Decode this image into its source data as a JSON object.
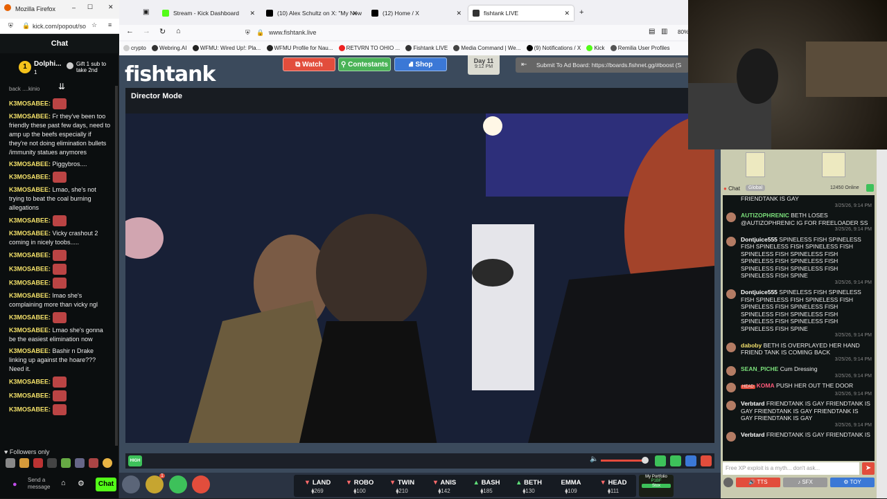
{
  "kick": {
    "window_title": "Mozilla Firefox",
    "url": "kick.com/popout/so",
    "header": "Chat",
    "pinned_user": "Dolphi...",
    "pinned_sub_count": "1",
    "gift_text": "Gift 1 sub to take 2nd",
    "partial_top": "back ....kinio",
    "messages": [
      {
        "user": "K3MOSABEE:",
        "text": ""
      },
      {
        "user": "K3MOSABEE:",
        "text": "Fr they've been too friendly these past few days, need to amp up the beefs especially if they're not doing elimination bullets /immunity statues anymores"
      },
      {
        "user": "K3MOSABEE:",
        "text": "Piggybros...."
      },
      {
        "user": "K3MOSABEE:",
        "text": ""
      },
      {
        "user": "K3MOSABEE:",
        "text": "Lmao, she's not trying to beat the coal burning allegations"
      },
      {
        "user": "K3MOSABEE:",
        "text": ""
      },
      {
        "user": "K3MOSABEE:",
        "text": "Vicky crashout 2 coming in nicely toobs....."
      },
      {
        "user": "K3MOSABEE:",
        "text": ""
      },
      {
        "user": "K3MOSABEE:",
        "text": ""
      },
      {
        "user": "K3MOSABEE:",
        "text": ""
      },
      {
        "user": "K3MOSABEE:",
        "text": "lmao she's complaining more than vicky ngl"
      },
      {
        "user": "K3MOSABEE:",
        "text": ""
      },
      {
        "user": "K3MOSABEE:",
        "text": "Lmao she's gonna be the easiest elimination now"
      },
      {
        "user": "K3MOSABEE:",
        "text": "Bashir n Drake linking up against the hoare??? Need it."
      },
      {
        "user": "K3MOSABEE:",
        "text": ""
      },
      {
        "user": "K3MOSABEE:",
        "text": ""
      },
      {
        "user": "K3MOSABEE:",
        "text": ""
      }
    ],
    "followers_only": "Followers only",
    "input_placeholder": "Send a message",
    "chat_button": "Chat"
  },
  "browser": {
    "tabs": [
      {
        "label": "Stream - Kick Dashboard",
        "color": "#53fc18"
      },
      {
        "label": "(10) Alex Schultz on X: \"My New",
        "color": "#000000"
      },
      {
        "label": "(12) Home / X",
        "color": "#000000"
      },
      {
        "label": "fishtank LIVE",
        "color": "#111111"
      }
    ],
    "url": "www.fishtank.live",
    "zoom": "80%",
    "bookmarks": [
      "crypto",
      "Webring.AI",
      "WFMU: Wired Up!: Pla...",
      "WFMU Profile for Nau...",
      "RETVRN TO OHIO ...",
      "Fishtank LIVE",
      "Media Command | We...",
      "(9) Notifications / X",
      "Kick",
      "Remilia User Profiles"
    ]
  },
  "fishtank": {
    "logo": "fishtank",
    "watch": "Watch",
    "contestants": "Contestants",
    "shop": "Shop",
    "day": "Day 11",
    "time": "9:12 PM",
    "ad_board": "Submit To Ad Board: https://boards.fishnet.gg/#boost (S",
    "director_mode": "Director Mode",
    "quality": "HIGH",
    "cast": [
      {
        "name": "LAND",
        "score": "269",
        "trend": "down",
        "color": "#ff6b6b"
      },
      {
        "name": "ROBO",
        "score": "100",
        "trend": "down",
        "color": "#ff6b6b"
      },
      {
        "name": "TWIN",
        "score": "210",
        "trend": "down",
        "color": "#ff6b6b"
      },
      {
        "name": "ANIS",
        "score": "142",
        "trend": "down",
        "color": "#ff6b6b"
      },
      {
        "name": "BASH",
        "score": "185",
        "trend": "up",
        "color": "#5fe07a"
      },
      {
        "name": "BETH",
        "score": "130",
        "trend": "up",
        "color": "#5fe07a"
      },
      {
        "name": "EMMA",
        "score": "109",
        "trend": "none",
        "color": "#ffffff"
      },
      {
        "name": "HEAD",
        "score": "111",
        "trend": "down",
        "color": "#ff6b6b"
      }
    ],
    "portfolio_label": "My Portfolio",
    "portfolio_value": "P1BF",
    "portfolio_btn": "Stox",
    "badge_count": "1"
  },
  "right_chat": {
    "tab_chat": "Chat",
    "tab_global": "Global",
    "online": "12450 Online",
    "first_partial": "FRIENDTANK IS GAY",
    "first_ts": "3/25/26, 9:14 PM",
    "messages": [
      {
        "user": "AUTIZOPHRENIC",
        "ucolor": "#7be07b",
        "text": "BETH LOSES @AUTIZOPHRENIC IG FOR FREELOADER SS",
        "ts": "3/25/26, 9:14 PM"
      },
      {
        "user": "Dontjuice555",
        "ucolor": "#ffffff",
        "text": "SPINELESS FISH SPINELESS FISH SPINELESS FISH SPINELESS FISH SPINELESS FISH SPINELESS FISH SPINELESS FISH SPINELESS FISH SPINELESS FISH SPINELESS FISH SPINELESS FISH SPINE",
        "ts": "3/25/26, 9:14 PM"
      },
      {
        "user": "Dontjuice555",
        "ucolor": "#ffffff",
        "text": "SPINELESS FISH SPINELESS FISH SPINELESS FISH SPINELESS FISH SPINELESS FISH SPINELESS FISH SPINELESS FISH SPINELESS FISH SPINELESS FISH SPINELESS FISH SPINELESS FISH SPINE",
        "ts": "3/25/26, 9:14 PM"
      },
      {
        "user": "daboby",
        "ucolor": "#f3e06b",
        "text": "BETH IS OVERPLAYED HER HAND FRIEND TANK IS COMING BACK",
        "ts": "3/25/26, 9:14 PM"
      },
      {
        "user": "SEAN_PICHE",
        "ucolor": "#7be07b",
        "text": "Cum Dressing",
        "ts": "3/25/26, 9:14 PM"
      },
      {
        "user": "KOMA",
        "ucolor": "#ff5a7a",
        "text": "PUSH HER OUT THE DOOR",
        "ts": "3/25/26, 9:14 PM",
        "badge": "HEAD"
      },
      {
        "user": "Verbtard",
        "ucolor": "#ffffff",
        "text": "FRIENDTANK IS GAY FRIENDTANK IS GAY FRIENDTANK IS GAY FRIENDTANK IS GAY FRIENDTANK IS GAY",
        "ts": "3/25/26, 9:14 PM"
      },
      {
        "user": "Verbtard",
        "ucolor": "#ffffff",
        "text": "FRIENDTANK IS GAY FRIENDTANK IS",
        "ts": ""
      }
    ],
    "input_placeholder": "Free XP exploit is a myth... don't ask...",
    "btn_tts": "TTS",
    "btn_sfx": "SFX",
    "btn_toy": "TOY"
  }
}
